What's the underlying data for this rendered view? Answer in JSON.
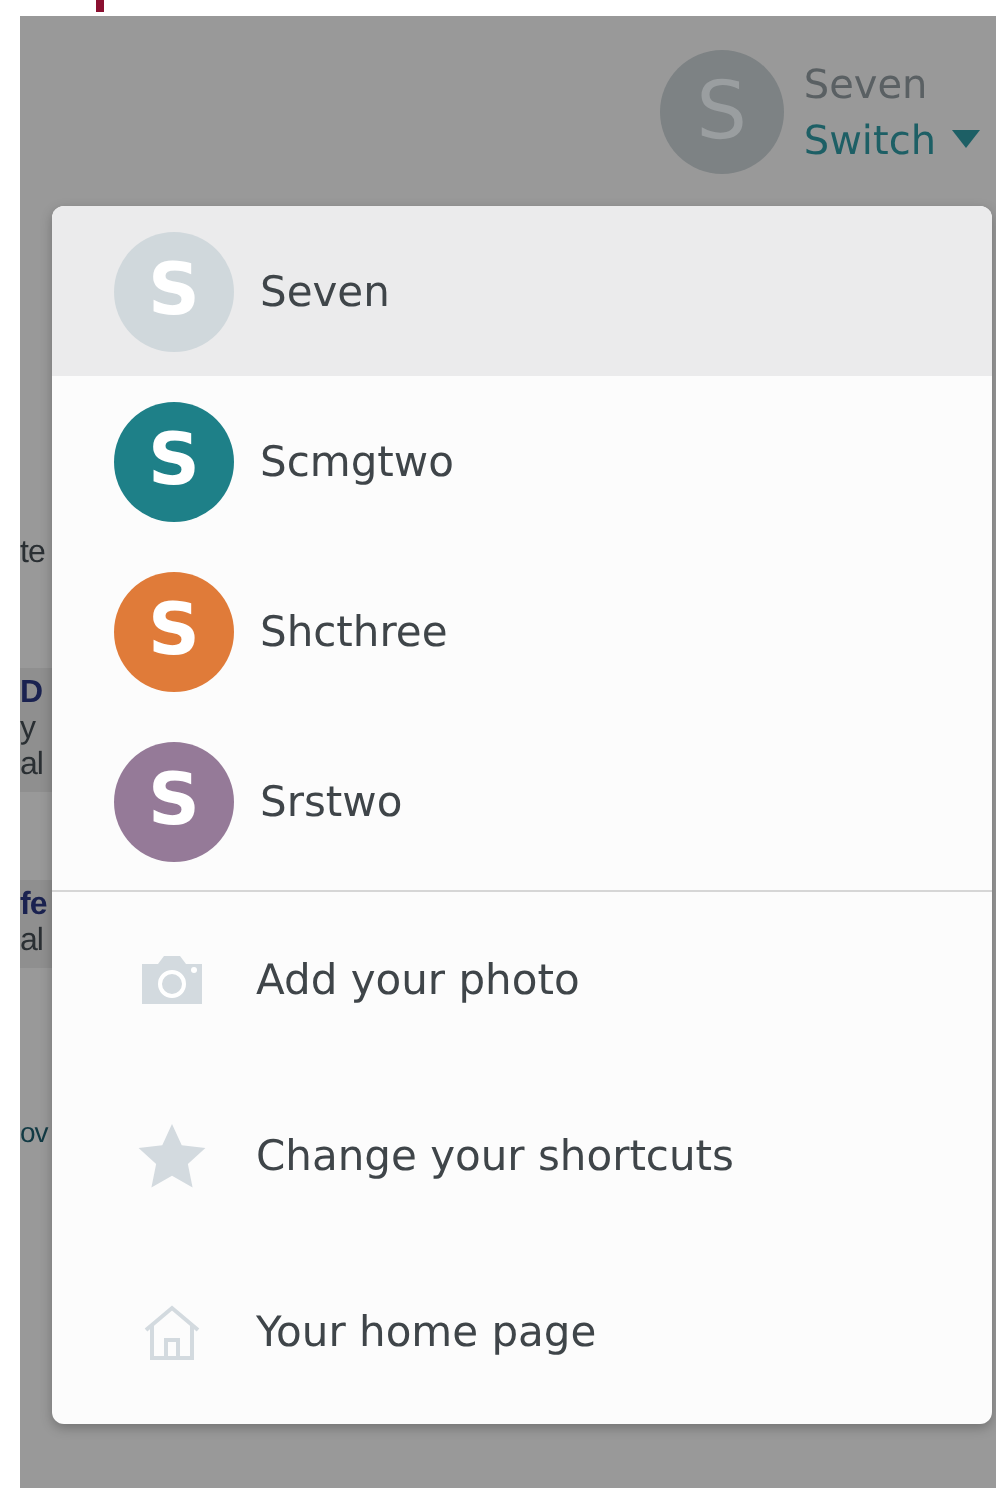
{
  "header": {
    "user_name": "Seven",
    "avatar_initial": "S",
    "switch_label": "Switch"
  },
  "background": {
    "heading": "te",
    "cards": [
      {
        "lines": [
          "D",
          "y",
          "al"
        ]
      },
      {
        "lines": [
          "fe",
          "al"
        ]
      }
    ],
    "link": "ov"
  },
  "menu": {
    "accounts": [
      {
        "initial": "S",
        "name": "Seven",
        "color": "#d0d8dc",
        "selected": true
      },
      {
        "initial": "S",
        "name": "Scmgtwo",
        "color": "#1e8088",
        "selected": false
      },
      {
        "initial": "S",
        "name": "Shcthree",
        "color": "#e07b39",
        "selected": false
      },
      {
        "initial": "S",
        "name": "Srstwo",
        "color": "#957a98",
        "selected": false
      }
    ],
    "actions": [
      {
        "kind": "camera",
        "label": "Add your photo"
      },
      {
        "kind": "star",
        "label": "Change your shortcuts"
      },
      {
        "kind": "home",
        "label": "Your home page"
      }
    ]
  }
}
